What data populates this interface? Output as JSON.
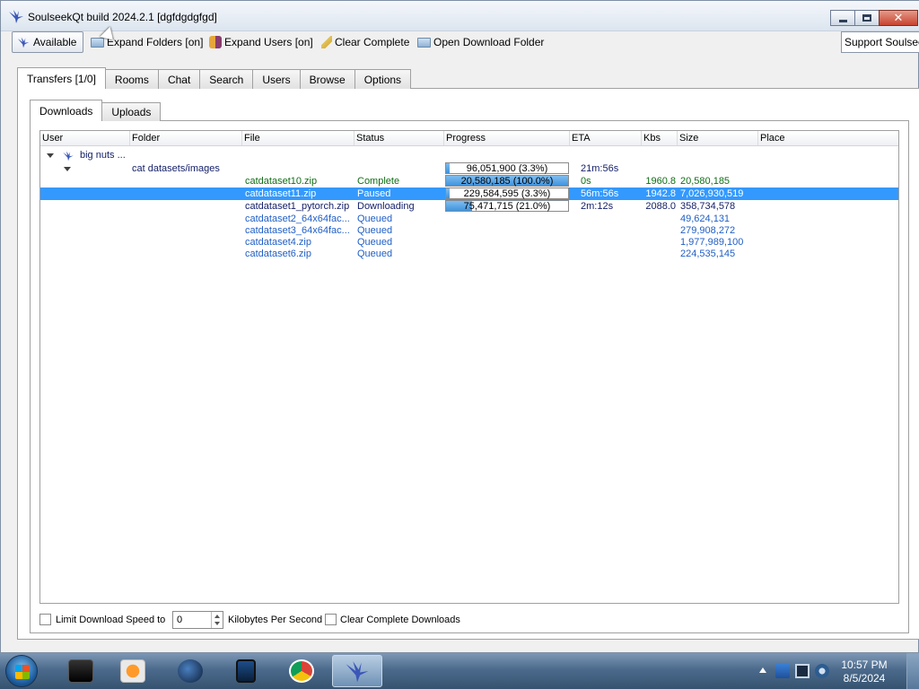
{
  "window": {
    "title": "SoulseekQt build 2024.2.1 [dgfdgdgfgd]",
    "close_glyph": "✕"
  },
  "toolbar": {
    "available_label": "Available",
    "expand_folders_label": "Expand Folders [on]",
    "expand_users_label": "Expand Users [on]",
    "clear_complete_label": "Clear Complete",
    "open_download_folder_label": "Open Download Folder",
    "support_label": "Support Soulseek"
  },
  "main_tabs": [
    {
      "label": "Transfers [1/0]",
      "active": true
    },
    {
      "label": "Rooms",
      "active": false
    },
    {
      "label": "Chat",
      "active": false
    },
    {
      "label": "Search",
      "active": false
    },
    {
      "label": "Users",
      "active": false
    },
    {
      "label": "Browse",
      "active": false
    },
    {
      "label": "Options",
      "active": false
    }
  ],
  "sub_tabs": [
    {
      "label": "Downloads",
      "active": true
    },
    {
      "label": "Uploads",
      "active": false
    }
  ],
  "table": {
    "columns": [
      "User",
      "Folder",
      "File",
      "Status",
      "Progress",
      "ETA",
      "Kbs",
      "Size",
      "Place"
    ],
    "user": "big nuts ...",
    "folder": {
      "name": "cat datasets/images",
      "progress_text": "96,051,900 (3.3%)",
      "progress_fraction": 0.033,
      "eta": "21m:56s"
    },
    "rows": [
      {
        "file": "catdataset10.zip",
        "status": "Complete",
        "progress_text": "20,580,185 (100.0%)",
        "progress_fraction": 1.0,
        "eta": "0s",
        "kbs": "1960.8",
        "size": "20,580,185",
        "style": "green"
      },
      {
        "file": "catdataset11.zip",
        "status": "Paused",
        "progress_text": "229,584,595 (3.3%)",
        "progress_fraction": 0.033,
        "eta": "56m:56s",
        "kbs": "1942.8",
        "size": "7,026,930,519",
        "style": "selected"
      },
      {
        "file": "catdataset1_pytorch.zip",
        "status": "Downloading",
        "progress_text": "75,471,715 (21.0%)",
        "progress_fraction": 0.21,
        "eta": "2m:12s",
        "kbs": "2088.0",
        "size": "358,734,578",
        "style": "navy"
      },
      {
        "file": "catdataset2_64x64fac...",
        "status": "Queued",
        "size": "49,624,131",
        "style": "blue"
      },
      {
        "file": "catdataset3_64x64fac...",
        "status": "Queued",
        "size": "279,908,272",
        "style": "blue"
      },
      {
        "file": "catdataset4.zip",
        "status": "Queued",
        "size": "1,977,989,100",
        "style": "blue"
      },
      {
        "file": "catdataset6.zip",
        "status": "Queued",
        "size": "224,535,145",
        "style": "blue"
      }
    ]
  },
  "bottom": {
    "limit_speed_label": "Limit Download Speed to",
    "speed_value": "0",
    "units_label": "Kilobytes Per Second",
    "clear_complete_label": "Clear Complete Downloads"
  },
  "taskbar": {
    "time": "10:57 PM",
    "date": "8/5/2024"
  }
}
